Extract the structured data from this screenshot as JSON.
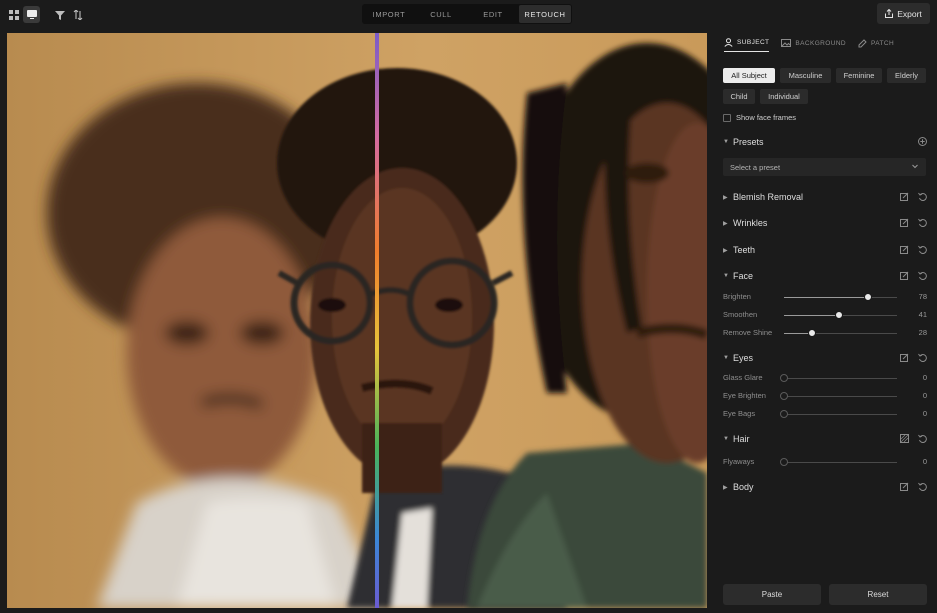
{
  "toolbar": {
    "modes": [
      "IMPORT",
      "CULL",
      "EDIT",
      "RETOUCH"
    ],
    "active_mode": "RETOUCH",
    "export_label": "Export"
  },
  "panel": {
    "tabs": [
      "SUBJECT",
      "BACKGROUND",
      "PATCH"
    ],
    "subject_filters": [
      "All Subject",
      "Masculine",
      "Feminine",
      "Elderly",
      "Child",
      "Individual"
    ],
    "show_face_frames": "Show face frames",
    "presets": {
      "title": "Presets",
      "placeholder": "Select a preset"
    },
    "sections": {
      "blemish": "Blemish Removal",
      "wrinkles": "Wrinkles",
      "teeth": "Teeth",
      "face": "Face",
      "eyes": "Eyes",
      "hair": "Hair",
      "body": "Body"
    },
    "face_sliders": [
      {
        "label": "Brighten",
        "value": "78",
        "fraction": 0.74
      },
      {
        "label": "Smoothen",
        "value": "41",
        "fraction": 0.49
      },
      {
        "label": "Remove Shine",
        "value": "28",
        "fraction": 0.25
      }
    ],
    "eyes_sliders": [
      {
        "label": "Glass Glare",
        "value": "0",
        "fraction": 0
      },
      {
        "label": "Eye Brighten",
        "value": "0",
        "fraction": 0
      },
      {
        "label": "Eye Bags",
        "value": "0",
        "fraction": 0
      }
    ],
    "hair_sliders": [
      {
        "label": "Flyaways",
        "value": "0",
        "fraction": 0
      }
    ],
    "paste_label": "Paste",
    "reset_label": "Reset"
  },
  "icons": {
    "grid": "grid-icon",
    "single": "single-view-icon",
    "filter": "filter-icon",
    "sort": "sort-icon",
    "export": "export-icon",
    "add": "plus-icon",
    "edit": "edit-icon",
    "undo": "undo-icon"
  },
  "colors": {
    "background": "#1b1b1b",
    "panel": "#1b1b1b",
    "chip_active": "#ececec",
    "photo_backdrop": "#c69a5c"
  }
}
